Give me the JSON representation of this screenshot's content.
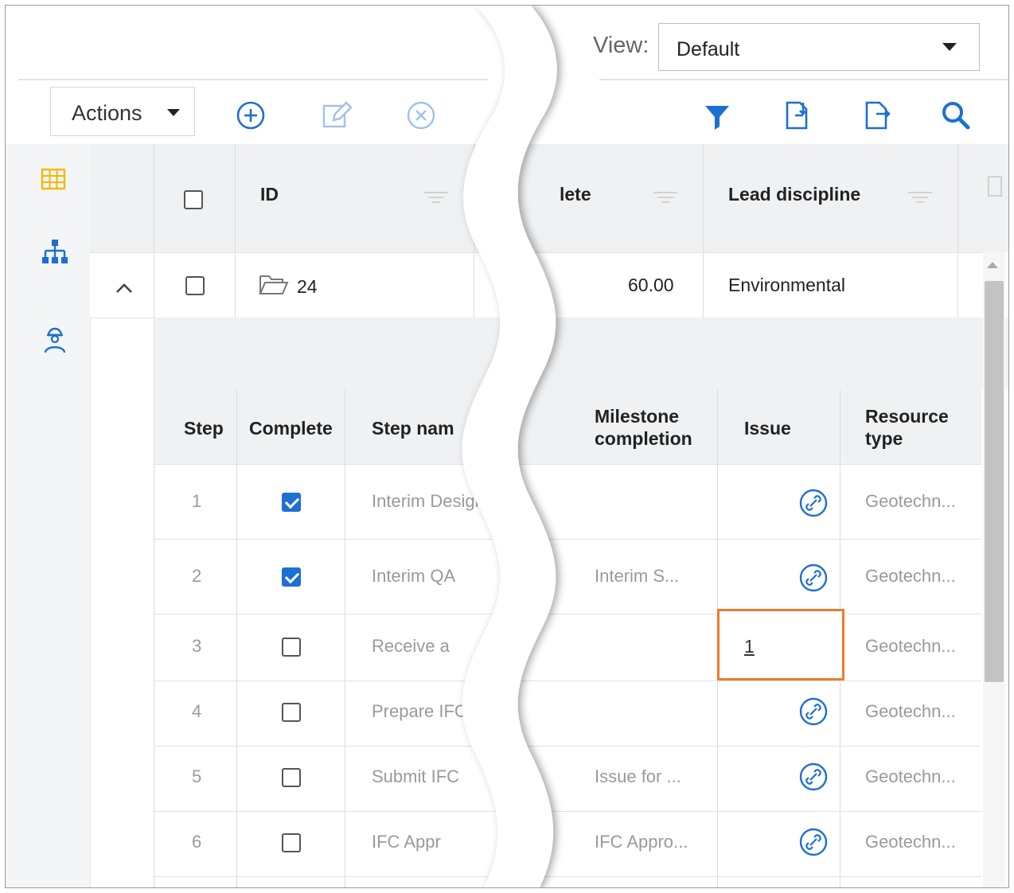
{
  "view": {
    "label": "View:",
    "selected": "Default"
  },
  "toolbar": {
    "actions_label": "Actions",
    "icons": [
      "add-circle-icon",
      "edit-icon",
      "delete-circle-icon",
      "filter-icon",
      "import-icon",
      "export-icon",
      "search-icon"
    ]
  },
  "sidenav": {
    "icons": [
      "grid-view-icon",
      "hierarchy-icon",
      "resource-person-icon"
    ]
  },
  "grid": {
    "headers": {
      "id": "ID",
      "complete_partial": "lete",
      "lead_discipline": "Lead discipline"
    },
    "group_row": {
      "id": "24",
      "percent_complete": "60.00",
      "lead_discipline": "Environmental"
    }
  },
  "subgrid": {
    "headers": {
      "step": "Step",
      "complete": "Complete",
      "step_name": "Step nam",
      "milestone": "Milestone completion",
      "milestone_line1": "Milestone",
      "milestone_line2": "completion",
      "issue": "Issue",
      "resource": "Resource type",
      "resource_line1": "Resource",
      "resource_line2": "type"
    },
    "rows": [
      {
        "step": "1",
        "complete": true,
        "step_name": "Interim Desigr",
        "milestone": "",
        "issue": "link",
        "resource": "Geotechn..."
      },
      {
        "step": "2",
        "complete": true,
        "step_name": "Interim QA",
        "milestone": "Interim S...",
        "issue": "link",
        "resource": "Geotechn..."
      },
      {
        "step": "3",
        "complete": false,
        "step_name": "Receive a",
        "milestone": "",
        "issue": "1",
        "resource": "Geotechn..."
      },
      {
        "step": "4",
        "complete": false,
        "step_name": "Prepare IFC P",
        "milestone": "",
        "issue": "link",
        "resource": "Geotechn..."
      },
      {
        "step": "5",
        "complete": false,
        "step_name": "Submit IFC",
        "milestone": "Issue for ...",
        "issue": "link",
        "resource": "Geotechn..."
      },
      {
        "step": "6",
        "complete": false,
        "step_name": "IFC Appr",
        "milestone": "IFC Appro...",
        "issue": "link",
        "resource": "Geotechn..."
      }
    ]
  },
  "colors": {
    "accent": "#1d6fd1",
    "highlight": "#f07b2e",
    "grid_icon": "#f5b800"
  }
}
